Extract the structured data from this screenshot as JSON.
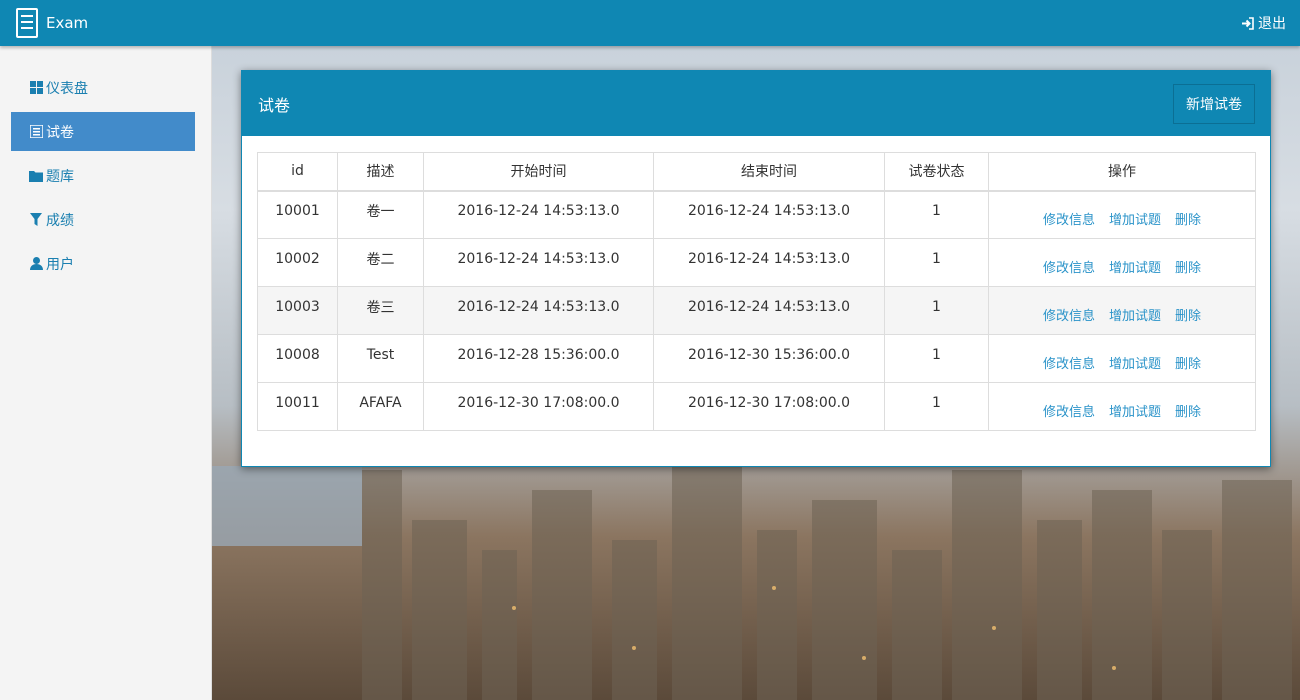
{
  "brand": {
    "name": "Exam",
    "icon": "notebook-icon"
  },
  "header": {
    "logout_label": "退出",
    "logout_icon": "sign-out-icon"
  },
  "sidebar": {
    "items": [
      {
        "label": "仪表盘",
        "icon": "grid-icon",
        "active": false
      },
      {
        "label": "试卷",
        "icon": "list-icon",
        "active": true
      },
      {
        "label": "题库",
        "icon": "folder-icon",
        "active": false
      },
      {
        "label": "成绩",
        "icon": "filter-icon",
        "active": false
      },
      {
        "label": "用户",
        "icon": "user-icon",
        "active": false
      }
    ]
  },
  "panel": {
    "title": "试卷",
    "add_button": "新增试卷"
  },
  "table": {
    "headers": [
      "id",
      "描述",
      "开始时间",
      "结束时间",
      "试卷状态",
      "操作"
    ],
    "rows": [
      {
        "id": "10001",
        "desc": "卷一",
        "start": "2016-12-24 14:53:13.0",
        "end": "2016-12-24 14:53:13.0",
        "status": "1"
      },
      {
        "id": "10002",
        "desc": "卷二",
        "start": "2016-12-24 14:53:13.0",
        "end": "2016-12-24 14:53:13.0",
        "status": "1"
      },
      {
        "id": "10003",
        "desc": "卷三",
        "start": "2016-12-24 14:53:13.0",
        "end": "2016-12-24 14:53:13.0",
        "status": "1"
      },
      {
        "id": "10008",
        "desc": "Test",
        "start": "2016-12-28 15:36:00.0",
        "end": "2016-12-30 15:36:00.0",
        "status": "1"
      },
      {
        "id": "10011",
        "desc": "AFAFA",
        "start": "2016-12-30 17:08:00.0",
        "end": "2016-12-30 17:08:00.0",
        "status": "1"
      }
    ],
    "actions": [
      "修改信息",
      "增加试题",
      "删除"
    ]
  },
  "colors": {
    "brand": "#0f87b3",
    "active_nav": "#428bca",
    "link": "#2a93c9"
  }
}
